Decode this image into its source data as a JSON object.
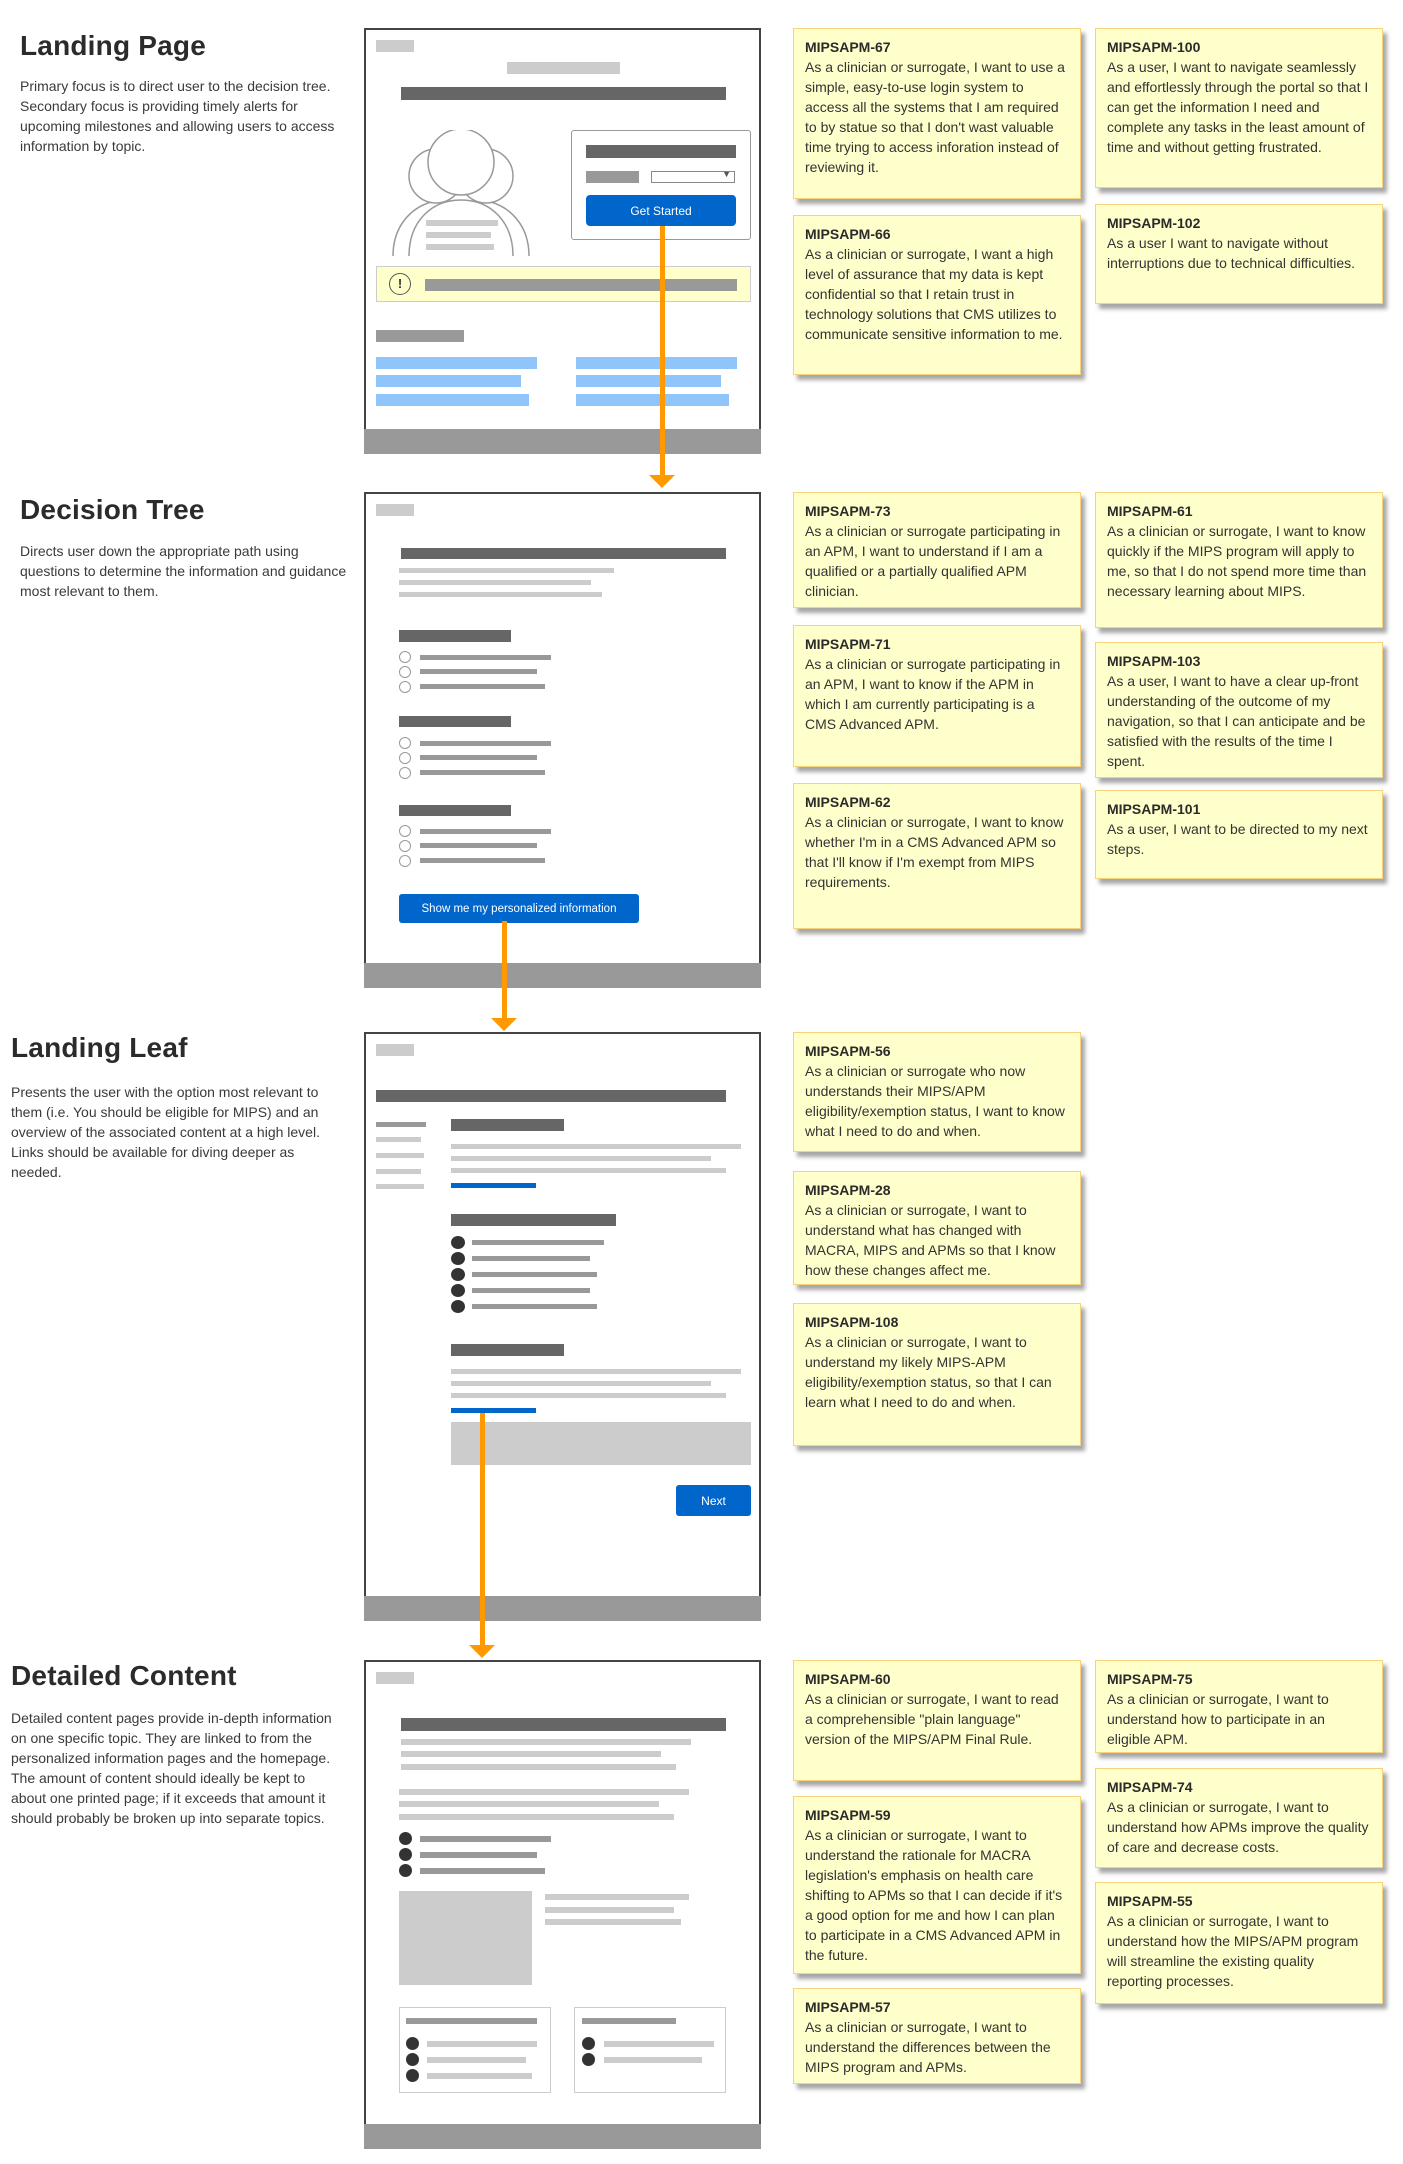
{
  "sections": [
    {
      "title": "Landing Page",
      "description": "Primary focus is to direct user to the decision tree. Secondary focus is providing timely alerts for upcoming milestones and allowing users to access information by topic.",
      "wireframe": {
        "button_label": "Get Started",
        "alert_icon": "!"
      },
      "stories": [
        {
          "id": "MIPSAPM-67",
          "text": "As a clinician or surrogate, I want to use a simple, easy-to-use login system to access all the systems that I am required to by statue so that I don't wast valuable time trying to access inforation instead of reviewing it."
        },
        {
          "id": "MIPSAPM-66",
          "text": "As a clinician or surrogate, I want a high level of assurance that my data is kept confidential so that I retain trust in technology solutions that CMS utilizes to communicate sensitive information to me."
        },
        {
          "id": "MIPSAPM-100",
          "text": "As a user, I want to navigate seamlessly and effortlessly through the portal so that I can get the information I need and complete any tasks in the least amount of time and without getting frustrated."
        },
        {
          "id": "MIPSAPM-102",
          "text": "As a user I want to navigate without interruptions due to technical difficulties."
        }
      ]
    },
    {
      "title": "Decision Tree",
      "description": "Directs user down the appropriate path using questions to determine the information and guidance most relevant to them.",
      "wireframe": {
        "button_label": "Show me my personalized information"
      },
      "stories": [
        {
          "id": "MIPSAPM-73",
          "text": "As a clinician or surrogate participating in an APM, I want to understand if I am a qualified or a partially qualified APM clinician."
        },
        {
          "id": "MIPSAPM-71",
          "text": "As a clinician or surrogate participating in an APM, I want to know if the APM in which I am currently participating is a CMS Advanced APM."
        },
        {
          "id": "MIPSAPM-62",
          "text": "As a clinician or surrogate, I want to know whether I'm in a CMS Advanced APM so that I'll know if I'm exempt from MIPS requirements."
        },
        {
          "id": "MIPSAPM-61",
          "text": "As a clinician or surrogate, I want to know quickly if the MIPS program will apply to me, so that I do not spend more time than necessary learning about MIPS."
        },
        {
          "id": "MIPSAPM-103",
          "text": "As a user, I want to have a clear up-front understanding of the outcome of my navigation, so that I can anticipate and be satisfied with the results of the time I spent."
        },
        {
          "id": "MIPSAPM-101",
          "text": "As a user, I want to be directed to my next steps."
        }
      ]
    },
    {
      "title": "Landing Leaf",
      "description": "Presents the user with the option most relevant to them (i.e. You should be eligible for MIPS) and an overview of the associated content at a high level. Links should be available for diving deeper as needed.",
      "wireframe": {
        "button_label": "Next"
      },
      "stories": [
        {
          "id": "MIPSAPM-56",
          "text": "As a clinician or surrogate who now understands their MIPS/APM eligibility/exemption status, I want to know what I need to do and when."
        },
        {
          "id": "MIPSAPM-28",
          "text": "As a clinician or surrogate, I want to understand what has changed with MACRA, MIPS and APMs so that I know how these changes affect me."
        },
        {
          "id": "MIPSAPM-108",
          "text": "As a clinician or surrogate, I want to understand my likely MIPS-APM eligibility/exemption status, so that I can learn what I need to do and when."
        }
      ]
    },
    {
      "title": "Detailed Content",
      "description": "Detailed content pages provide in-depth information on one specific topic. They are linked to from the personalized information pages and the homepage. The amount of content should ideally be kept to about one printed page; if it exceeds that amount it should probably be broken up into separate topics.",
      "stories": [
        {
          "id": "MIPSAPM-60",
          "text": "As a clinician or surrogate, I want to read a comprehensible \"plain language\" version of the MIPS/APM Final Rule."
        },
        {
          "id": "MIPSAPM-59",
          "text": "As a clinician or surrogate, I want to understand the rationale for MACRA legislation's emphasis on health care shifting to APMs so that I can decide if it's a good option for me and how I can plan to participate in a CMS Advanced APM in the future."
        },
        {
          "id": "MIPSAPM-57",
          "text": "As a clinician or surrogate, I want to understand the differences between the MIPS program and APMs."
        },
        {
          "id": "MIPSAPM-75",
          "text": "As a clinician or surrogate, I want to understand how to participate in an eligible APM."
        },
        {
          "id": "MIPSAPM-74",
          "text": "As a clinician or surrogate, I want to understand how APMs improve the quality of care and decrease costs."
        },
        {
          "id": "MIPSAPM-55",
          "text": "As a clinician or surrogate, I want to understand how the MIPS/APM program will streamline the existing quality reporting processes."
        }
      ]
    }
  ],
  "colors": {
    "sticky_bg": "#ffffcc",
    "sticky_border": "#f7d27a",
    "primary_button": "#0066cc",
    "flow_arrow": "#ff9900",
    "link_placeholder": "#90c5fb",
    "alert_bg": "#ffffcc"
  }
}
